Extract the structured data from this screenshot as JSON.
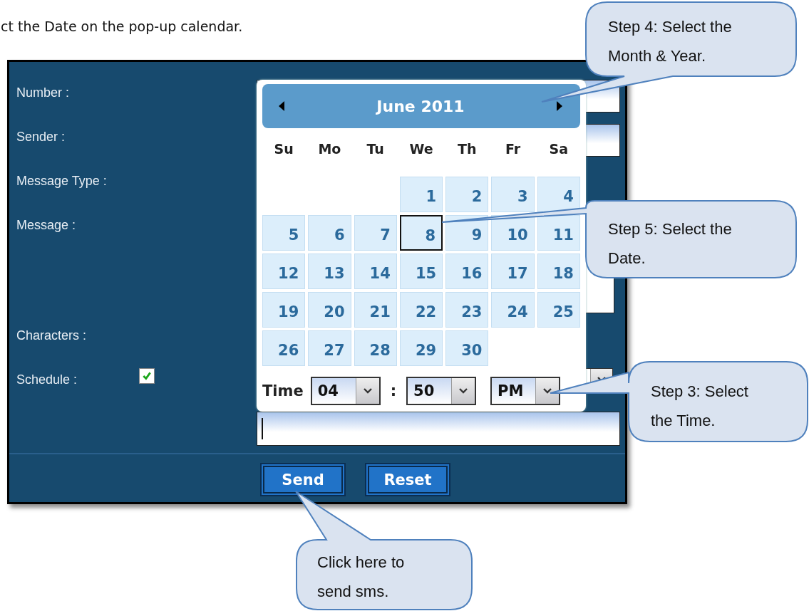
{
  "intro_text": "ct the Date on the pop-up calendar.",
  "form": {
    "rows": [
      {
        "label": "Number :",
        "kind": "input"
      },
      {
        "label": "Sender :",
        "kind": "input"
      },
      {
        "label": "Message Type :",
        "kind": "plain"
      },
      {
        "label": "Message :",
        "kind": "textarea"
      },
      {
        "label": "Characters :",
        "kind": "plain"
      },
      {
        "label": "Schedule :",
        "kind": "schedule",
        "checked": true
      }
    ],
    "buttons": [
      "Send",
      "Reset"
    ]
  },
  "calendar": {
    "title": "June 2011",
    "weekdays": [
      "Su",
      "Mo",
      "Tu",
      "We",
      "Th",
      "Fr",
      "Sa"
    ],
    "weeks": [
      {
        "days": [
          {
            "label": "1",
            "selected": false
          },
          {
            "label": "2",
            "selected": false
          },
          {
            "label": "3",
            "selected": false
          },
          {
            "label": "4",
            "selected": false
          }
        ]
      },
      {
        "days": [
          {
            "label": "5",
            "selected": false
          },
          {
            "label": "6",
            "selected": false
          },
          {
            "label": "7",
            "selected": false
          },
          {
            "label": "8",
            "selected": true
          },
          {
            "label": "9",
            "selected": false
          },
          {
            "label": "10",
            "selected": false
          },
          {
            "label": "11",
            "selected": false
          }
        ]
      },
      {
        "days": [
          {
            "label": "12",
            "selected": false
          },
          {
            "label": "13",
            "selected": false
          },
          {
            "label": "14",
            "selected": false
          },
          {
            "label": "15",
            "selected": false
          },
          {
            "label": "16",
            "selected": false
          },
          {
            "label": "17",
            "selected": false
          },
          {
            "label": "18",
            "selected": false
          }
        ]
      },
      {
        "days": [
          {
            "label": "19",
            "selected": false
          },
          {
            "label": "20",
            "selected": false
          },
          {
            "label": "21",
            "selected": false
          },
          {
            "label": "22",
            "selected": false
          },
          {
            "label": "23",
            "selected": false
          },
          {
            "label": "24",
            "selected": false
          },
          {
            "label": "25",
            "selected": false
          }
        ]
      },
      {
        "days": [
          {
            "label": "26",
            "selected": false
          },
          {
            "label": "27",
            "selected": false
          },
          {
            "label": "28",
            "selected": false
          },
          {
            "label": "29",
            "selected": false
          },
          {
            "label": "30",
            "selected": false
          }
        ]
      }
    ],
    "time": {
      "label": "Time",
      "hour": "04",
      "separator": ":",
      "minute": "50",
      "period": "PM"
    }
  },
  "callouts": [
    {
      "text": "Step 4: Select the Month & Year."
    },
    {
      "text": "Step 5: Select the Date."
    },
    {
      "text": "Step 3: Select the Time."
    },
    {
      "text": "Click here to send sms."
    }
  ]
}
